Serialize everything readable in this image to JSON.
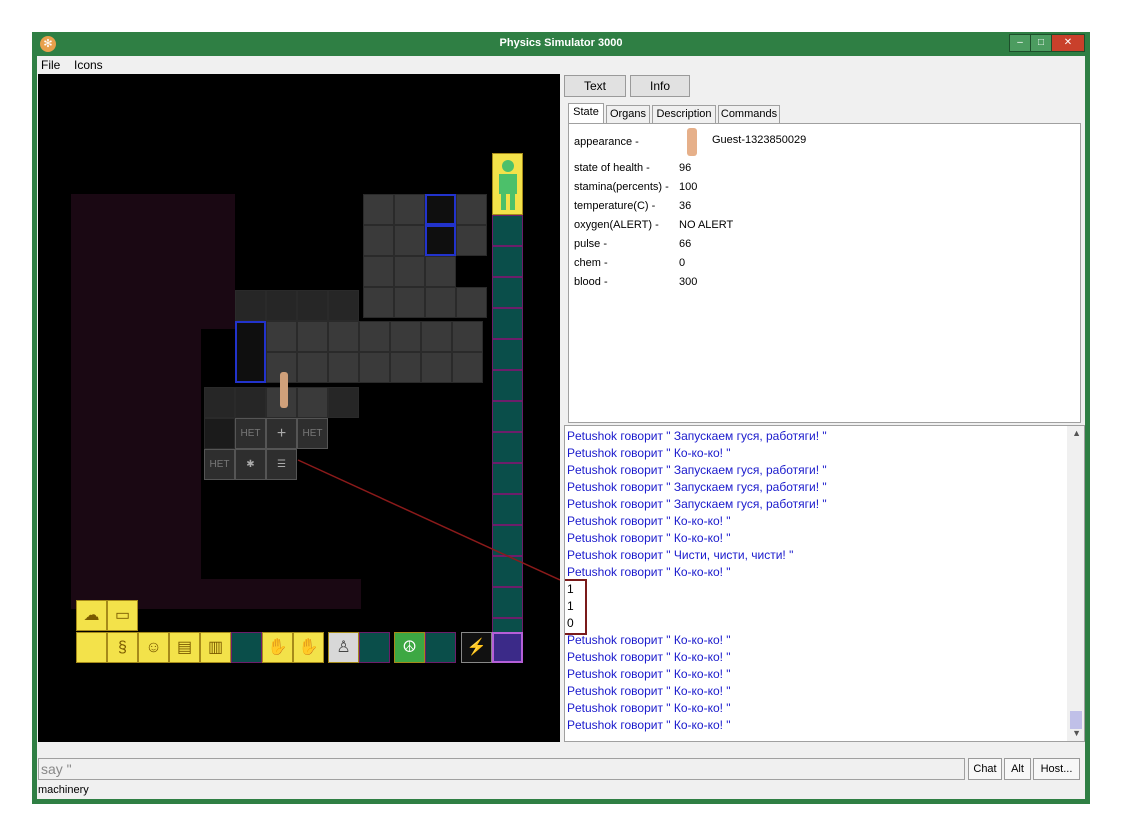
{
  "window": {
    "title": "Physics Simulator 3000"
  },
  "menu": {
    "file": "File",
    "icons": "Icons"
  },
  "panel": {
    "text_btn": "Text",
    "info_btn": "Info"
  },
  "tabs": [
    "State",
    "Organs",
    "Description",
    "Commands"
  ],
  "state": {
    "appearance_label": "appearance -",
    "appearance_value": "Guest-1323850029",
    "rows": [
      {
        "label": "state of health -",
        "value": "96"
      },
      {
        "label": "stamina(percents) -",
        "value": "100"
      },
      {
        "label": "temperature(C) -",
        "value": "36"
      },
      {
        "label": "oxygen(ALERT) -",
        "value": "NO ALERT"
      },
      {
        "label": "pulse -",
        "value": "66"
      },
      {
        "label": "chem -",
        "value": "0"
      },
      {
        "label": "blood -",
        "value": "300"
      }
    ]
  },
  "log": [
    "Petushok говорит \" Запускаем гуся, работяги! \"",
    "Petushok говорит \" Ко-ко-ко! \"",
    "Petushok говорит \" Запускаем гуся, работяги! \"",
    "Petushok говорит \" Запускаем гуся, работяги! \"",
    "Petushok говорит \" Запускаем гуся, работяги! \"",
    "Petushok говорит \" Ко-ко-ко! \"",
    "Petushok говорит \" Ко-ко-ко! \"",
    "Petushok говорит \" Чисти, чисти, чисти! \"",
    "Petushok говорит \" Ко-ко-ко! \"",
    "1",
    "1",
    "0",
    "Petushok говорит \" Ко-ко-ко! \"",
    "Petushok говорит \" Ко-ко-ко! \"",
    "Petushok говорит \" Ко-ко-ко! \"",
    "Petushok говорит \" Ко-ко-ко! \"",
    "Petushok говорит \" Ко-ко-ко! \"",
    "Petushok говорит \" Ко-ко-ко! \""
  ],
  "map": {
    "het_label": "НЕТ"
  },
  "input": {
    "value": "say \""
  },
  "buttons": {
    "chat": "Chat",
    "alt": "Alt",
    "host": "Host..."
  },
  "status": {
    "text": "machinery"
  },
  "colors": {
    "frame": "#2f7f44",
    "log_text": "#1a1acc",
    "slot": "#f3e24a"
  }
}
